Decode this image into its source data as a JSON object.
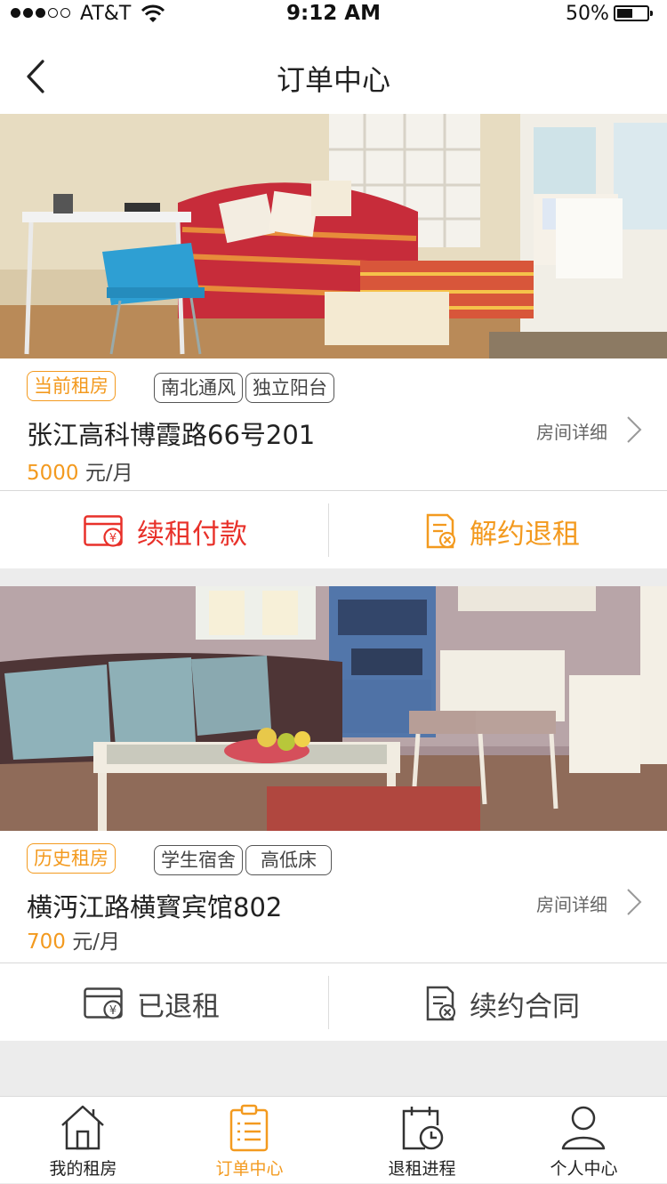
{
  "status_bar": {
    "carrier": "AT&T",
    "time": "9:12 AM",
    "battery": "50%",
    "battery_level": 0.5
  },
  "nav": {
    "title": "订单中心",
    "back_icon": "chevron-left-icon"
  },
  "orders": [
    {
      "status_tag": "当前租房",
      "features": [
        "南北通风",
        "独立阳台"
      ],
      "address": "张江高科博霞路66号201",
      "price": "5000",
      "price_unit": "元/月",
      "detail_link": "房间详细",
      "actions": [
        {
          "label": "续租付款",
          "icon": "yuan-card-icon",
          "color": "#e8312a"
        },
        {
          "label": "解约退租",
          "icon": "cancel-document-icon",
          "color": "#f39a1f"
        }
      ]
    },
    {
      "status_tag": "历史租房",
      "features": [
        "学生宿舍",
        "高低床"
      ],
      "address": "横沔江路横寳宾馆802",
      "price": "700",
      "price_unit": "元/月",
      "detail_link": "房间详细",
      "actions": [
        {
          "label": "已退租",
          "icon": "yuan-card-icon",
          "color": "#444444"
        },
        {
          "label": "续约合同",
          "icon": "cancel-document-icon",
          "color": "#444444"
        }
      ]
    }
  ],
  "tabbar": {
    "active_index": 1,
    "accent": "#f39a1f",
    "tabs": [
      {
        "label": "我的租房",
        "icon": "house-icon"
      },
      {
        "label": "订单中心",
        "icon": "clipboard-list-icon"
      },
      {
        "label": "退租进程",
        "icon": "calendar-clock-icon"
      },
      {
        "label": "个人中心",
        "icon": "person-icon"
      }
    ]
  }
}
